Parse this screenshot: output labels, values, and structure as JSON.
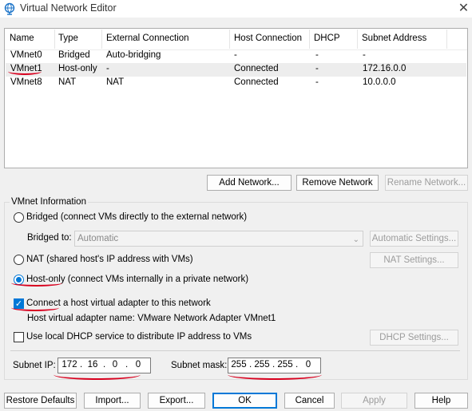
{
  "window": {
    "title": "Virtual Network Editor",
    "close_glyph": "✕"
  },
  "table": {
    "columns": [
      "Name",
      "Type",
      "External Connection",
      "Host Connection",
      "DHCP",
      "Subnet Address"
    ],
    "rows": [
      [
        "VMnet0",
        "Bridged",
        "Auto-bridging",
        "-",
        "-",
        "-"
      ],
      [
        "VMnet1",
        "Host-only",
        "-",
        "Connected",
        "-",
        "172.16.0.0"
      ],
      [
        "VMnet8",
        "NAT",
        "NAT",
        "Connected",
        "-",
        "10.0.0.0"
      ]
    ],
    "selected_row": 1
  },
  "list_buttons": {
    "add": "Add Network...",
    "remove": "Remove Network",
    "rename": "Rename Network..."
  },
  "vmnet_info": {
    "group_label": "VMnet Information",
    "bridged_label": "Bridged (connect VMs directly to the external network)",
    "bridged_to_label": "Bridged to:",
    "bridged_to_value": "Automatic",
    "auto_settings": "Automatic Settings...",
    "nat_label": "NAT (shared host's IP address with VMs)",
    "nat_settings": "NAT Settings...",
    "hostonly_label": "Host-only",
    "hostonly_desc": " (connect VMs internally in a private network)",
    "selected_mode": "Host-only",
    "connect_adapter_label": "Connect",
    "connect_adapter_rest": " a host virtual adapter to this network",
    "connect_adapter_checked": true,
    "adapter_name_label": "Host virtual adapter name: VMware Network Adapter VMnet1",
    "dhcp_label": "Use local DHCP service to distribute IP address to VMs",
    "dhcp_checked": false,
    "dhcp_settings": "DHCP Settings...",
    "subnet_ip_label": "Subnet IP:",
    "subnet_ip": [
      "172",
      "16",
      "0",
      "0"
    ],
    "subnet_mask_label": "Subnet mask:",
    "subnet_mask": [
      "255",
      "255",
      "255",
      "0"
    ]
  },
  "footer": {
    "restore": "Restore Defaults",
    "import": "Import...",
    "export": "Export...",
    "ok": "OK",
    "cancel": "Cancel",
    "apply": "Apply",
    "help": "Help"
  },
  "colors": {
    "accent": "#0078d7",
    "annotation": "#d8001e"
  }
}
